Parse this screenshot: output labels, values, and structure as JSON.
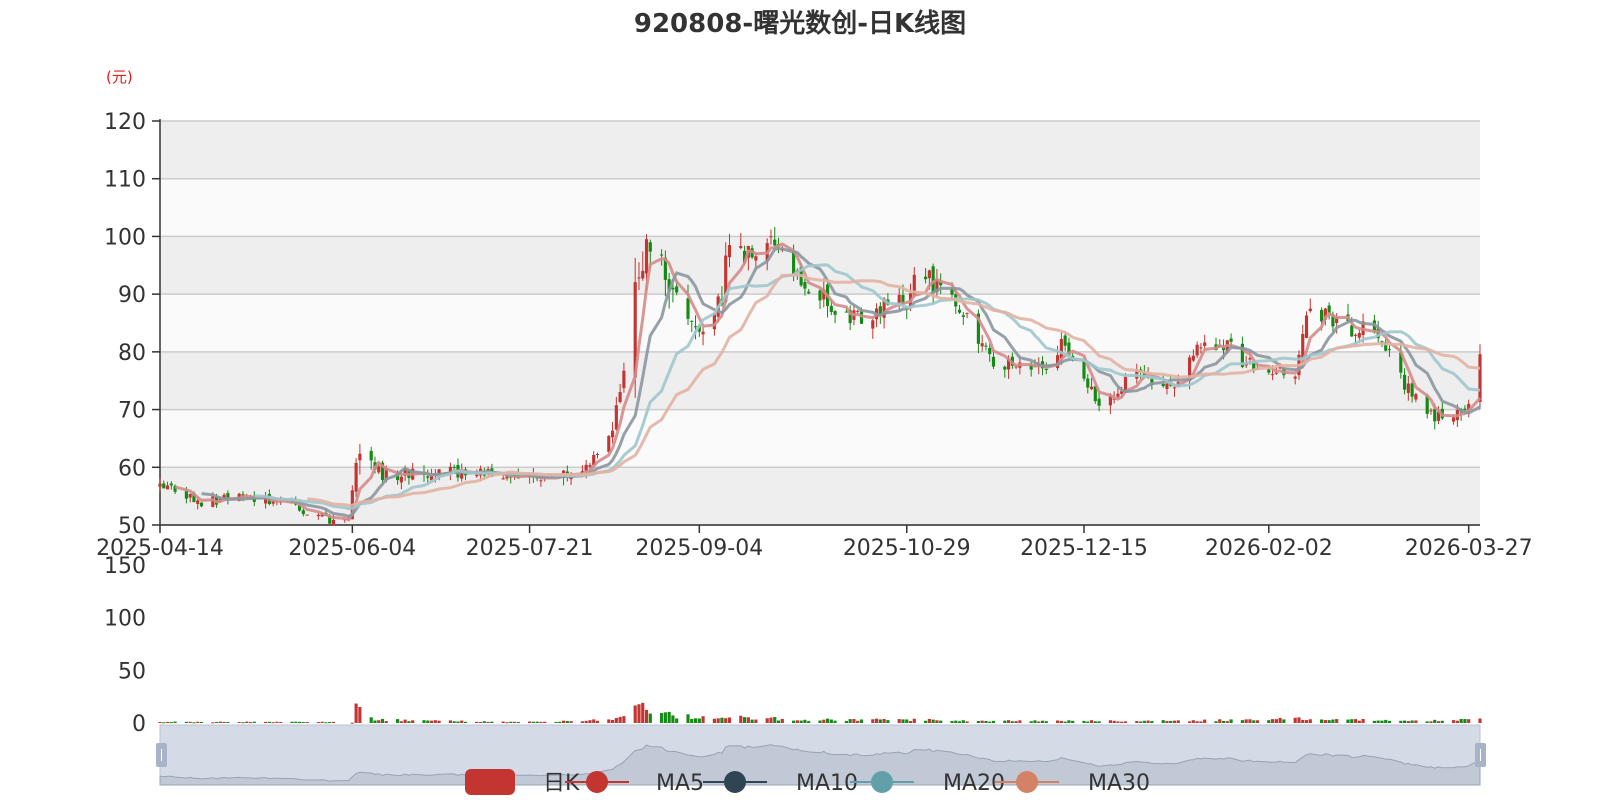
{
  "chart_data": {
    "type": "candlestick",
    "title": "920808-曙光数创-日K线图",
    "y_unit": "(元)",
    "ylim": [
      50,
      120
    ],
    "y_ticks": [
      "50",
      "60",
      "70",
      "80",
      "90",
      "100",
      "110",
      "120"
    ],
    "x_ticks": [
      "2025-04-14",
      "2025-06-04",
      "2025-07-21",
      "2025-09-04",
      "2025-10-29",
      "2025-12-15",
      "2026-02-02",
      "2026-03-27"
    ],
    "volume_ylim": [
      0,
      150
    ],
    "volume_ticks": [
      "0",
      "50",
      "100",
      "150"
    ],
    "legend": [
      "日K",
      "MA5",
      "MA10",
      "MA20",
      "MA30"
    ],
    "series_colors": {
      "up": "#c23531",
      "down": "#138a13",
      "MA5": "#d48b8b",
      "MA10": "#8b96a0",
      "MA20": "#9ec7cc",
      "MA30": "#e2b3a3"
    },
    "price_anchors": [
      [
        "2025-04-14",
        57
      ],
      [
        "2025-04-25",
        54
      ],
      [
        "2025-05-08",
        55
      ],
      [
        "2025-05-20",
        53
      ],
      [
        "2025-05-29",
        51
      ],
      [
        "2025-06-03",
        51
      ],
      [
        "2025-06-05",
        61
      ],
      [
        "2025-06-12",
        59
      ],
      [
        "2025-06-20",
        59
      ],
      [
        "2025-07-01",
        59
      ],
      [
        "2025-07-10",
        59
      ],
      [
        "2025-07-21",
        58.5
      ],
      [
        "2025-08-01",
        59
      ],
      [
        "2025-08-06",
        61
      ],
      [
        "2025-08-12",
        66
      ],
      [
        "2025-08-15",
        78
      ],
      [
        "2025-08-18",
        96
      ],
      [
        "2025-08-22",
        99
      ],
      [
        "2025-08-28",
        92
      ],
      [
        "2025-09-02",
        85
      ],
      [
        "2025-09-05",
        83
      ],
      [
        "2025-09-10",
        90
      ],
      [
        "2025-09-12",
        100
      ],
      [
        "2025-09-16",
        97
      ],
      [
        "2025-09-19",
        96
      ],
      [
        "2025-09-24",
        99
      ],
      [
        "2025-09-30",
        93
      ],
      [
        "2025-10-13",
        86
      ],
      [
        "2025-10-20",
        86
      ],
      [
        "2025-10-24",
        89
      ],
      [
        "2025-10-29",
        88
      ],
      [
        "2025-10-31",
        95
      ],
      [
        "2025-11-06",
        91
      ],
      [
        "2025-11-14",
        86
      ],
      [
        "2025-11-21",
        78
      ],
      [
        "2025-12-01",
        78
      ],
      [
        "2025-12-05",
        77
      ],
      [
        "2025-12-10",
        82
      ],
      [
        "2025-12-19",
        71
      ],
      [
        "2025-12-29",
        76
      ],
      [
        "2026-01-07",
        74
      ],
      [
        "2026-01-14",
        80
      ],
      [
        "2026-01-22",
        81
      ],
      [
        "2026-01-27",
        78
      ],
      [
        "2026-02-02",
        76
      ],
      [
        "2026-02-09",
        76
      ],
      [
        "2026-02-13",
        88
      ],
      [
        "2026-02-24",
        84
      ],
      [
        "2026-02-28",
        84
      ],
      [
        "2026-03-06",
        80
      ],
      [
        "2026-03-12",
        72
      ],
      [
        "2026-03-20",
        68
      ],
      [
        "2026-03-27",
        71
      ],
      [
        "2026-03-30",
        78
      ]
    ],
    "volume_anchors": [
      [
        "2025-04-14",
        1
      ],
      [
        "2025-05-30",
        1
      ],
      [
        "2025-06-04",
        0
      ],
      [
        "2025-06-05",
        14
      ],
      [
        "2025-06-10",
        3
      ],
      [
        "2025-07-15",
        1
      ],
      [
        "2025-08-05",
        2
      ],
      [
        "2025-08-14",
        5
      ],
      [
        "2025-08-19",
        15
      ],
      [
        "2025-08-29",
        6
      ],
      [
        "2025-09-12",
        6
      ],
      [
        "2025-10-01",
        3
      ],
      [
        "2025-10-31",
        3
      ],
      [
        "2025-11-20",
        2
      ],
      [
        "2025-12-10",
        2
      ],
      [
        "2026-01-10",
        2
      ],
      [
        "2026-02-12",
        4
      ],
      [
        "2026-03-10",
        2
      ],
      [
        "2026-03-30",
        3
      ]
    ]
  }
}
